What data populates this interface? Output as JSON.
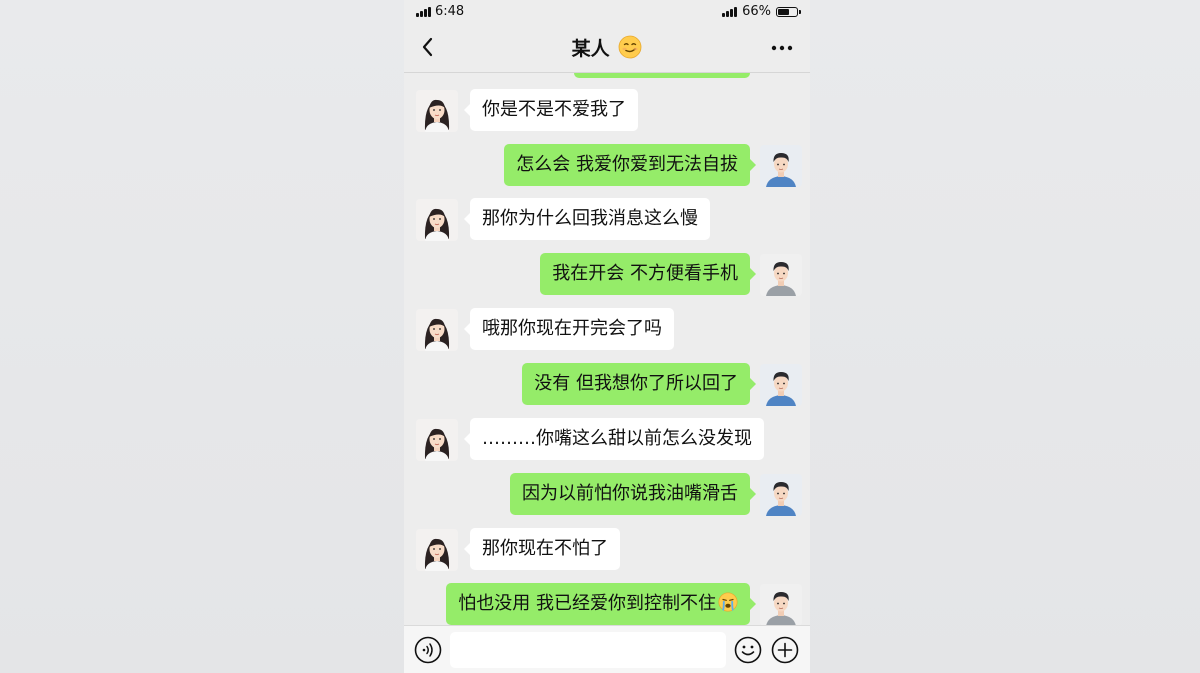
{
  "status_bar": {
    "time": "6:48",
    "battery_percent": "66%",
    "battery_level": 0.66
  },
  "header": {
    "title": "某人",
    "title_emoji_icon": "smirk-emoji-icon",
    "back_icon": "chevron-left-icon",
    "more_icon": "more-dots-icon"
  },
  "messages": [
    {
      "side": "left",
      "text": "你是不是不爱我了"
    },
    {
      "side": "right",
      "text": "怎么会 我爱你爱到无法自拔"
    },
    {
      "side": "left",
      "text": "那你为什么回我消息这么慢"
    },
    {
      "side": "right",
      "text": "我在开会 不方便看手机"
    },
    {
      "side": "left",
      "text": "哦那你现在开完会了吗"
    },
    {
      "side": "right",
      "text": "没有 但我想你了所以回了"
    },
    {
      "side": "left",
      "text": "………你嘴这么甜以前怎么没发现"
    },
    {
      "side": "right",
      "text": "因为以前怕你说我油嘴滑舌"
    },
    {
      "side": "left",
      "text": "那你现在不怕了"
    },
    {
      "side": "right",
      "text": "怕也没用 我已经爱你到控制不住",
      "trailing_emoji_icon": "crying-emoji-icon"
    }
  ],
  "input_bar": {
    "voice_icon": "voice-icon",
    "emoji_icon": "emoji-icon",
    "plus_icon": "plus-icon",
    "input_value": ""
  },
  "colors": {
    "chat_background": "#ededed",
    "sent_bubble": "#95ec69",
    "received_bubble": "#ffffff"
  }
}
